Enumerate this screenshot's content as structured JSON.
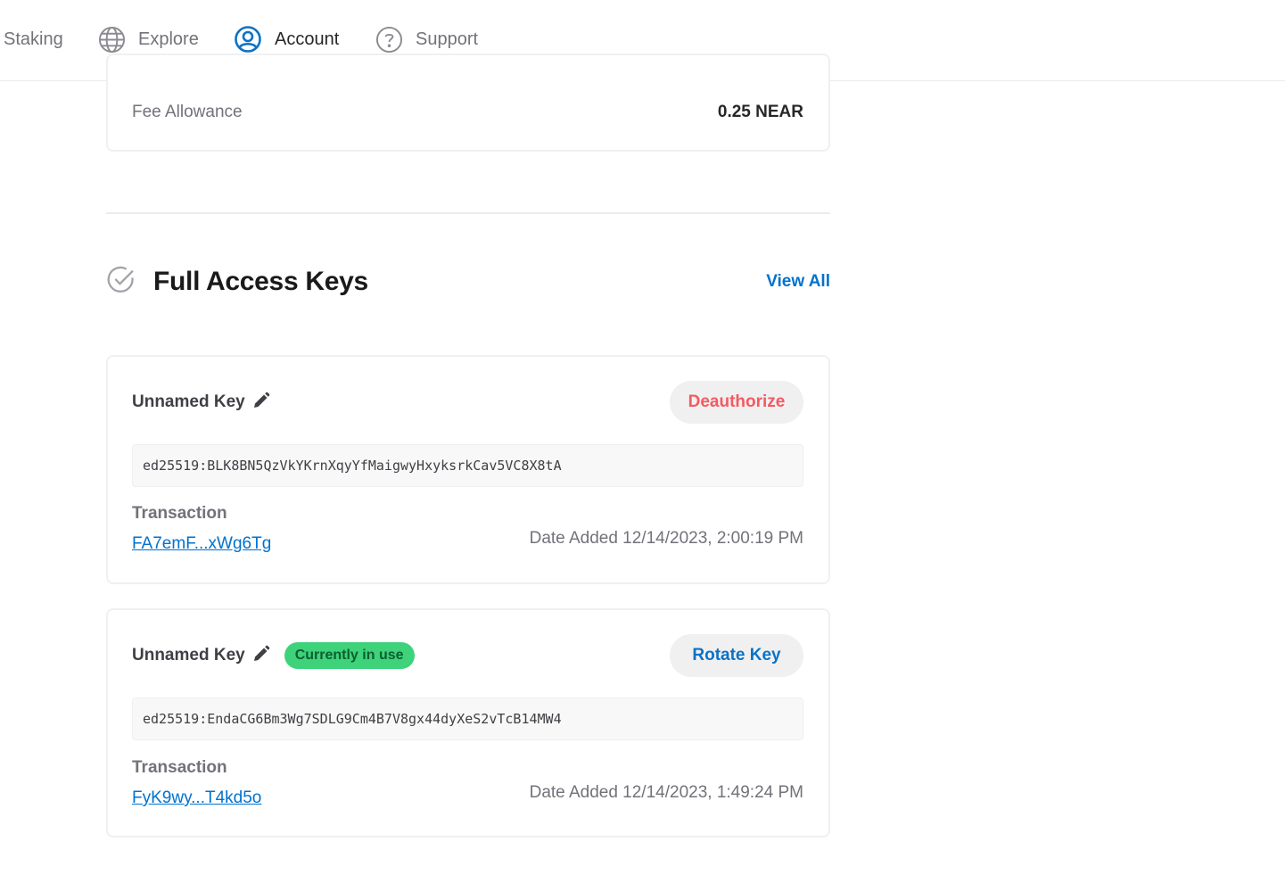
{
  "nav": {
    "items": [
      {
        "label": "Staking",
        "icon": "staking-icon",
        "active": false
      },
      {
        "label": "Explore",
        "icon": "globe-icon",
        "active": false
      },
      {
        "label": "Account",
        "icon": "user-circle-icon",
        "active": true
      },
      {
        "label": "Support",
        "icon": "question-circle-icon",
        "active": false
      }
    ]
  },
  "fee": {
    "label": "Fee Allowance",
    "value": "0.25 NEAR"
  },
  "section": {
    "title": "Full Access Keys",
    "view_all": "View All",
    "icon": "check-circle-icon"
  },
  "keys": [
    {
      "name": "Unnamed Key",
      "badge": "",
      "action": "Deauthorize",
      "public_key": "ed25519:BLK8BN5QzVkYKrnXqyYfMaigwyHxyksrkCav5VC8X8tA",
      "tx_label": "Transaction",
      "tx_hash": "FA7emF...xWg6Tg",
      "date_added": "Date Added 12/14/2023, 2:00:19 PM"
    },
    {
      "name": "Unnamed Key",
      "badge": "Currently in use",
      "action": "Rotate Key",
      "public_key": "ed25519:EndaCG6Bm3Wg7SDLG9Cm4B7V8gx44dyXeS2vTcB14MW4",
      "tx_label": "Transaction",
      "tx_hash": "FyK9wy...T4kd5o",
      "date_added": "Date Added 12/14/2023, 1:49:24 PM"
    }
  ],
  "colors": {
    "accent": "#0072ce",
    "danger": "#f45a61",
    "success_badge": "#3ed27a"
  }
}
